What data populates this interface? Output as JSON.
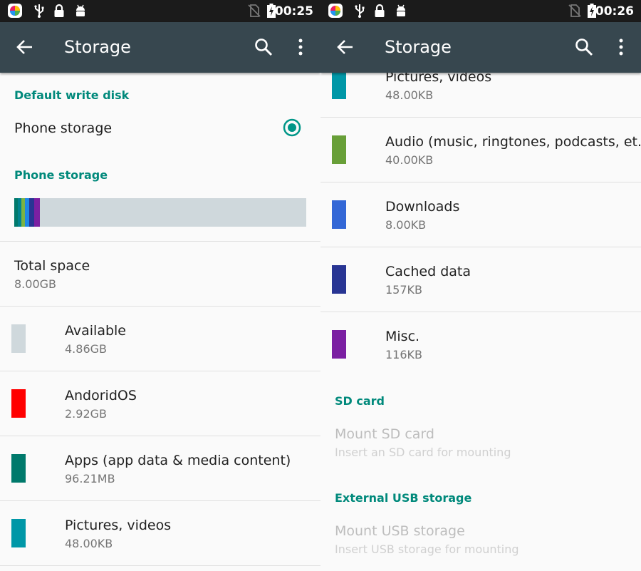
{
  "left": {
    "status": {
      "time": "00:25"
    },
    "toolbar": {
      "title": "Storage"
    },
    "default_write_disk": {
      "header": "Default write disk",
      "option": "Phone storage"
    },
    "phone_storage": {
      "header": "Phone storage",
      "bar_segments": [
        {
          "name": "AndoridOS",
          "color": "#00796b",
          "fraction": 0.012
        },
        {
          "name": "Apps",
          "color": "#00838f",
          "fraction": 0.012
        },
        {
          "name": "Pictures",
          "color": "#7cb342",
          "fraction": 0.012
        },
        {
          "name": "Audio",
          "color": "#1e88e5",
          "fraction": 0.015
        },
        {
          "name": "Downloads",
          "color": "#283593",
          "fraction": 0.017
        },
        {
          "name": "Misc",
          "color": "#7b1fa2",
          "fraction": 0.02
        }
      ],
      "bar_background": "#cfd8dc"
    },
    "total": {
      "title": "Total space",
      "value": "8.00GB"
    },
    "items": [
      {
        "label": "Available",
        "size": "4.86GB",
        "color": "#cfd8dc"
      },
      {
        "label": "AndoridOS",
        "size": "2.92GB",
        "color": "#ff0000"
      },
      {
        "label": "Apps (app data & media content)",
        "size": "96.21MB",
        "color": "#00796b"
      },
      {
        "label": "Pictures, videos",
        "size": "48.00KB",
        "color": "#0097a7"
      }
    ]
  },
  "right": {
    "status": {
      "time": "00:26"
    },
    "toolbar": {
      "title": "Storage"
    },
    "items": [
      {
        "label": "Pictures, videos",
        "size": "48.00KB",
        "color": "#0097a7"
      },
      {
        "label": "Audio (music, ringtones, podcasts, et..",
        "size": "40.00KB",
        "color": "#689f38"
      },
      {
        "label": "Downloads",
        "size": "8.00KB",
        "color": "#3367d6"
      },
      {
        "label": "Cached data",
        "size": "157KB",
        "color": "#283593"
      },
      {
        "label": "Misc.",
        "size": "116KB",
        "color": "#7b1fa2"
      }
    ],
    "sd_card": {
      "header": "SD card",
      "title": "Mount SD card",
      "sub": "Insert an SD card for mounting"
    },
    "usb": {
      "header": "External USB storage",
      "title": "Mount USB storage",
      "sub": "Insert USB storage for mounting"
    }
  },
  "icons": [
    "app-icon",
    "usb-icon",
    "lock-icon",
    "android-icon",
    "no-sim-icon",
    "battery-charging-icon",
    "back-arrow-icon",
    "search-icon",
    "more-vert-icon",
    "radio-checked-icon"
  ]
}
